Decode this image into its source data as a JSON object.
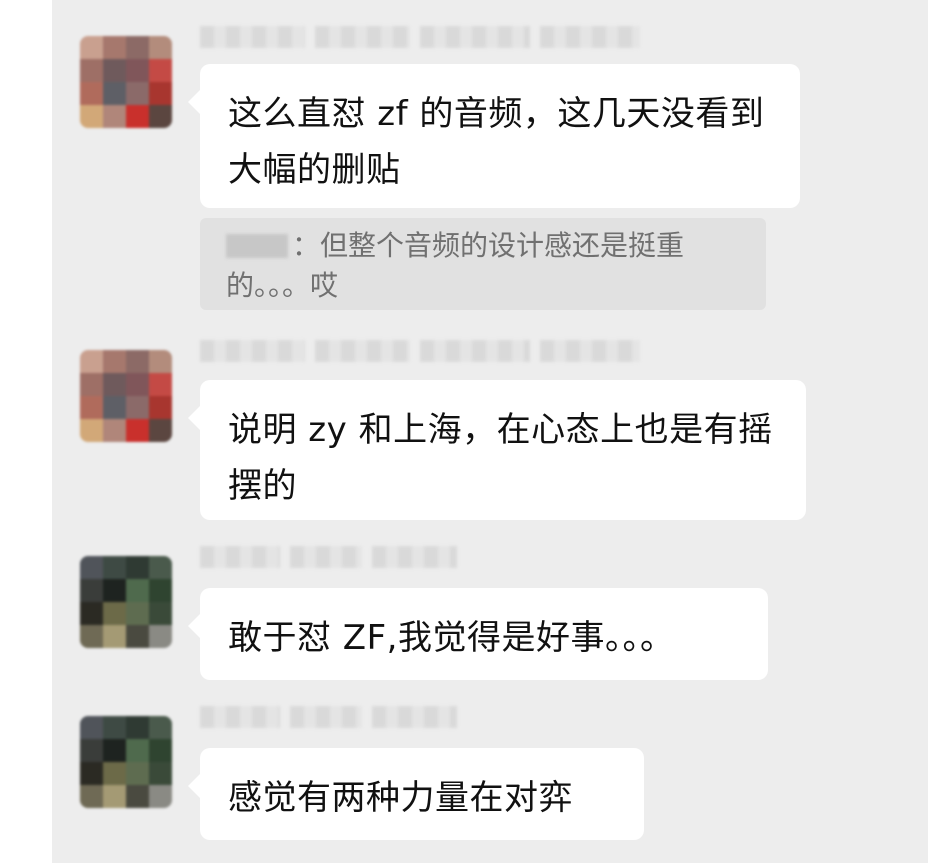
{
  "chat": {
    "messages": [
      {
        "sender": "",
        "text": "这么直怼 zf 的音频，这几天没看到大幅的删贴",
        "avatar_icon": "pixelated-avatar-icon"
      },
      {
        "sender": "",
        "text": "说明 zy 和上海，在心态上也是有摇摆的",
        "avatar_icon": "pixelated-avatar-icon"
      },
      {
        "sender": "",
        "text": "敢于怼 ZF,我觉得是好事。。。",
        "avatar_icon": "pixelated-avatar-icon"
      },
      {
        "sender": "",
        "text": "感觉有两种力量在对弈",
        "avatar_icon": "pixelated-avatar-icon"
      }
    ],
    "quote": {
      "text": "：但整个音频的设计感还是挺重的。。。哎"
    }
  },
  "colors": {
    "chat_background": "#ededed",
    "bubble": "#ffffff",
    "quote_background": "#e1e1e1",
    "message_text": "#111111",
    "quote_text": "#707070"
  }
}
